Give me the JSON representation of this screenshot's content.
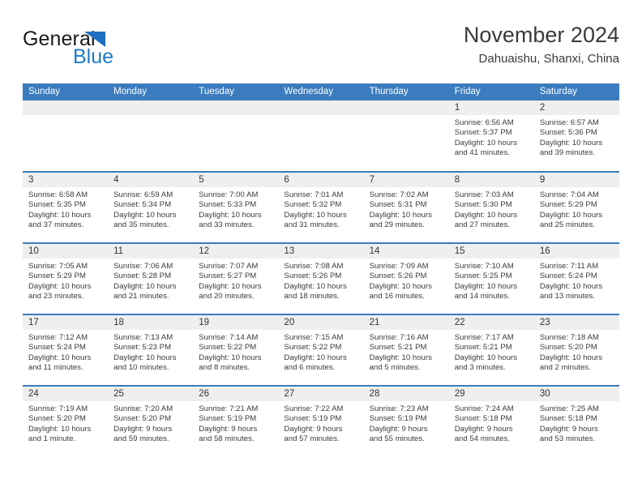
{
  "brand": {
    "word_one": "General",
    "word_two": "Blue",
    "triangle_color": "#1f6fc0"
  },
  "header": {
    "title": "November 2024",
    "location": "Dahuaishu, Shanxi, China",
    "accent_color": "#3b7cbf",
    "strip_color": "#efefef"
  },
  "calendar": {
    "weekday_headers": [
      "Sunday",
      "Monday",
      "Tuesday",
      "Wednesday",
      "Thursday",
      "Friday",
      "Saturday"
    ],
    "labels": {
      "sunrise": "Sunrise:",
      "sunset": "Sunset:",
      "daylight": "Daylight:"
    },
    "weeks": [
      [
        {
          "day": "",
          "sunrise": "",
          "sunset": "",
          "daylight_1": "",
          "daylight_2": ""
        },
        {
          "day": "",
          "sunrise": "",
          "sunset": "",
          "daylight_1": "",
          "daylight_2": ""
        },
        {
          "day": "",
          "sunrise": "",
          "sunset": "",
          "daylight_1": "",
          "daylight_2": ""
        },
        {
          "day": "",
          "sunrise": "",
          "sunset": "",
          "daylight_1": "",
          "daylight_2": ""
        },
        {
          "day": "",
          "sunrise": "",
          "sunset": "",
          "daylight_1": "",
          "daylight_2": ""
        },
        {
          "day": "1",
          "sunrise": "Sunrise: 6:56 AM",
          "sunset": "Sunset: 5:37 PM",
          "daylight_1": "Daylight: 10 hours",
          "daylight_2": "and 41 minutes."
        },
        {
          "day": "2",
          "sunrise": "Sunrise: 6:57 AM",
          "sunset": "Sunset: 5:36 PM",
          "daylight_1": "Daylight: 10 hours",
          "daylight_2": "and 39 minutes."
        }
      ],
      [
        {
          "day": "3",
          "sunrise": "Sunrise: 6:58 AM",
          "sunset": "Sunset: 5:35 PM",
          "daylight_1": "Daylight: 10 hours",
          "daylight_2": "and 37 minutes."
        },
        {
          "day": "4",
          "sunrise": "Sunrise: 6:59 AM",
          "sunset": "Sunset: 5:34 PM",
          "daylight_1": "Daylight: 10 hours",
          "daylight_2": "and 35 minutes."
        },
        {
          "day": "5",
          "sunrise": "Sunrise: 7:00 AM",
          "sunset": "Sunset: 5:33 PM",
          "daylight_1": "Daylight: 10 hours",
          "daylight_2": "and 33 minutes."
        },
        {
          "day": "6",
          "sunrise": "Sunrise: 7:01 AM",
          "sunset": "Sunset: 5:32 PM",
          "daylight_1": "Daylight: 10 hours",
          "daylight_2": "and 31 minutes."
        },
        {
          "day": "7",
          "sunrise": "Sunrise: 7:02 AM",
          "sunset": "Sunset: 5:31 PM",
          "daylight_1": "Daylight: 10 hours",
          "daylight_2": "and 29 minutes."
        },
        {
          "day": "8",
          "sunrise": "Sunrise: 7:03 AM",
          "sunset": "Sunset: 5:30 PM",
          "daylight_1": "Daylight: 10 hours",
          "daylight_2": "and 27 minutes."
        },
        {
          "day": "9",
          "sunrise": "Sunrise: 7:04 AM",
          "sunset": "Sunset: 5:29 PM",
          "daylight_1": "Daylight: 10 hours",
          "daylight_2": "and 25 minutes."
        }
      ],
      [
        {
          "day": "10",
          "sunrise": "Sunrise: 7:05 AM",
          "sunset": "Sunset: 5:29 PM",
          "daylight_1": "Daylight: 10 hours",
          "daylight_2": "and 23 minutes."
        },
        {
          "day": "11",
          "sunrise": "Sunrise: 7:06 AM",
          "sunset": "Sunset: 5:28 PM",
          "daylight_1": "Daylight: 10 hours",
          "daylight_2": "and 21 minutes."
        },
        {
          "day": "12",
          "sunrise": "Sunrise: 7:07 AM",
          "sunset": "Sunset: 5:27 PM",
          "daylight_1": "Daylight: 10 hours",
          "daylight_2": "and 20 minutes."
        },
        {
          "day": "13",
          "sunrise": "Sunrise: 7:08 AM",
          "sunset": "Sunset: 5:26 PM",
          "daylight_1": "Daylight: 10 hours",
          "daylight_2": "and 18 minutes."
        },
        {
          "day": "14",
          "sunrise": "Sunrise: 7:09 AM",
          "sunset": "Sunset: 5:26 PM",
          "daylight_1": "Daylight: 10 hours",
          "daylight_2": "and 16 minutes."
        },
        {
          "day": "15",
          "sunrise": "Sunrise: 7:10 AM",
          "sunset": "Sunset: 5:25 PM",
          "daylight_1": "Daylight: 10 hours",
          "daylight_2": "and 14 minutes."
        },
        {
          "day": "16",
          "sunrise": "Sunrise: 7:11 AM",
          "sunset": "Sunset: 5:24 PM",
          "daylight_1": "Daylight: 10 hours",
          "daylight_2": "and 13 minutes."
        }
      ],
      [
        {
          "day": "17",
          "sunrise": "Sunrise: 7:12 AM",
          "sunset": "Sunset: 5:24 PM",
          "daylight_1": "Daylight: 10 hours",
          "daylight_2": "and 11 minutes."
        },
        {
          "day": "18",
          "sunrise": "Sunrise: 7:13 AM",
          "sunset": "Sunset: 5:23 PM",
          "daylight_1": "Daylight: 10 hours",
          "daylight_2": "and 10 minutes."
        },
        {
          "day": "19",
          "sunrise": "Sunrise: 7:14 AM",
          "sunset": "Sunset: 5:22 PM",
          "daylight_1": "Daylight: 10 hours",
          "daylight_2": "and 8 minutes."
        },
        {
          "day": "20",
          "sunrise": "Sunrise: 7:15 AM",
          "sunset": "Sunset: 5:22 PM",
          "daylight_1": "Daylight: 10 hours",
          "daylight_2": "and 6 minutes."
        },
        {
          "day": "21",
          "sunrise": "Sunrise: 7:16 AM",
          "sunset": "Sunset: 5:21 PM",
          "daylight_1": "Daylight: 10 hours",
          "daylight_2": "and 5 minutes."
        },
        {
          "day": "22",
          "sunrise": "Sunrise: 7:17 AM",
          "sunset": "Sunset: 5:21 PM",
          "daylight_1": "Daylight: 10 hours",
          "daylight_2": "and 3 minutes."
        },
        {
          "day": "23",
          "sunrise": "Sunrise: 7:18 AM",
          "sunset": "Sunset: 5:20 PM",
          "daylight_1": "Daylight: 10 hours",
          "daylight_2": "and 2 minutes."
        }
      ],
      [
        {
          "day": "24",
          "sunrise": "Sunrise: 7:19 AM",
          "sunset": "Sunset: 5:20 PM",
          "daylight_1": "Daylight: 10 hours",
          "daylight_2": "and 1 minute."
        },
        {
          "day": "25",
          "sunrise": "Sunrise: 7:20 AM",
          "sunset": "Sunset: 5:20 PM",
          "daylight_1": "Daylight: 9 hours",
          "daylight_2": "and 59 minutes."
        },
        {
          "day": "26",
          "sunrise": "Sunrise: 7:21 AM",
          "sunset": "Sunset: 5:19 PM",
          "daylight_1": "Daylight: 9 hours",
          "daylight_2": "and 58 minutes."
        },
        {
          "day": "27",
          "sunrise": "Sunrise: 7:22 AM",
          "sunset": "Sunset: 5:19 PM",
          "daylight_1": "Daylight: 9 hours",
          "daylight_2": "and 57 minutes."
        },
        {
          "day": "28",
          "sunrise": "Sunrise: 7:23 AM",
          "sunset": "Sunset: 5:19 PM",
          "daylight_1": "Daylight: 9 hours",
          "daylight_2": "and 55 minutes."
        },
        {
          "day": "29",
          "sunrise": "Sunrise: 7:24 AM",
          "sunset": "Sunset: 5:18 PM",
          "daylight_1": "Daylight: 9 hours",
          "daylight_2": "and 54 minutes."
        },
        {
          "day": "30",
          "sunrise": "Sunrise: 7:25 AM",
          "sunset": "Sunset: 5:18 PM",
          "daylight_1": "Daylight: 9 hours",
          "daylight_2": "and 53 minutes."
        }
      ]
    ]
  }
}
